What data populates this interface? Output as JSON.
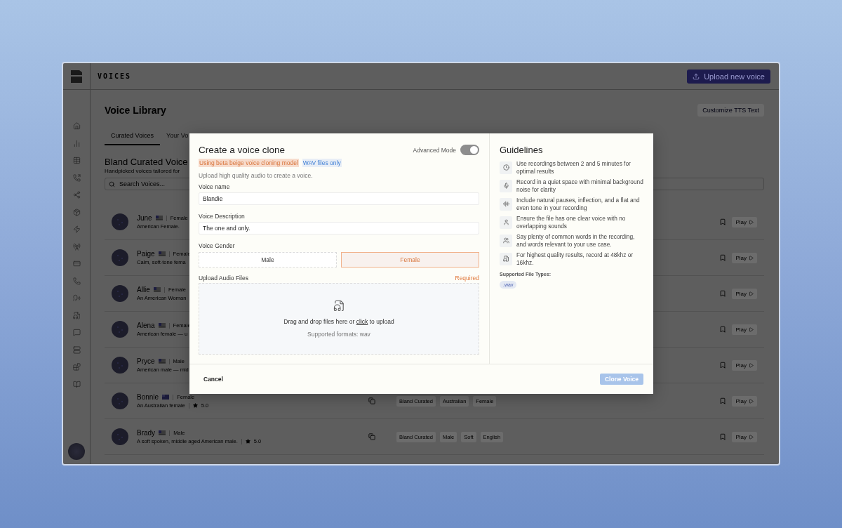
{
  "app": {
    "section_title": "VOICES",
    "upload_button": "Upload new voice"
  },
  "library": {
    "title": "Voice Library",
    "customize_button": "Customize TTS Text",
    "tabs": [
      {
        "label": "Curated Voices",
        "selected": true
      },
      {
        "label": "Your Vo",
        "selected": false
      }
    ],
    "heading": "Bland Curated Voice",
    "subtitle": "Handpicked voices tailored for",
    "search": {
      "placeholder": "Search Voices..."
    },
    "voices": [
      {
        "name": "June",
        "kind": "us",
        "gender": "Female",
        "description": "American Female.",
        "play": "Play"
      },
      {
        "name": "Paige",
        "kind": "us",
        "gender": "Female",
        "description": "Calm, soft-tone fema",
        "play": "Play"
      },
      {
        "name": "Allie",
        "kind": "us",
        "gender": "Female",
        "description": "An American Woman",
        "play": "Play"
      },
      {
        "name": "Alena",
        "kind": "us",
        "gender": "Female",
        "description": "American female — u",
        "play": "Play"
      },
      {
        "name": "Pryce",
        "kind": "us",
        "gender": "Male",
        "description": "American male — mid",
        "play": "Play"
      },
      {
        "name": "Bonnie",
        "kind": "au",
        "gender": "Female",
        "description": "An Australian female",
        "rating": "5.0",
        "tags": [
          "Bland Curated",
          "Australian",
          "Female"
        ],
        "play": "Play"
      },
      {
        "name": "Brady",
        "kind": "us",
        "gender": "Male",
        "description": "A soft spoken, middle aged American male.",
        "rating": "5.0",
        "tags": [
          "Bland Curated",
          "Male",
          "Soft",
          "English"
        ],
        "play": "Play"
      }
    ]
  },
  "modal": {
    "title": "Create a voice clone",
    "badges": [
      {
        "text": "Using beta beige voice cloning model",
        "kind": "warning"
      },
      {
        "text": "WAV files only",
        "kind": "info"
      }
    ],
    "advanced_mode": {
      "label": "Advanced Mode",
      "on": true
    },
    "intro": "Upload high quality audio to create a voice.",
    "fields": [
      {
        "label": "Voice name",
        "value": "Blandie"
      },
      {
        "label": "Voice Description",
        "value": "The one and only."
      }
    ],
    "gender": {
      "label": "Voice Gender",
      "options": [
        {
          "label": "Male",
          "selected": false
        },
        {
          "label": "Female",
          "selected": true
        }
      ]
    },
    "upload": {
      "label": "Upload Audio Files",
      "required": "Required",
      "prompt_before": "Drag and drop files here or",
      "link": "click",
      "prompt_after": "to upload",
      "formats": "Supported formats: wav"
    },
    "guidelines": {
      "title": "Guidelines",
      "items": [
        {
          "kind": "clock",
          "text": "Use recordings between 2 and 5 minutes for optimal results"
        },
        {
          "kind": "mic",
          "text": "Record in a quiet space with minimal background noise for clarity"
        },
        {
          "kind": "wave",
          "text": "Include natural pauses, inflection, and a flat and even tone in your recording"
        },
        {
          "kind": "person",
          "text": "Ensure the file has one clear voice with no overlapping sounds"
        },
        {
          "kind": "group",
          "text": "Say plenty of common words in the recording, and words relevant to your use case."
        },
        {
          "kind": "file",
          "text": "For highest quality results, record at 48khz or 16khz."
        }
      ],
      "file_types_label": "Supported File Types:",
      "file_types": [
        ".wav"
      ]
    },
    "cancel": "Cancel",
    "submit": {
      "label": "Clone Voice",
      "disabled": true
    }
  }
}
